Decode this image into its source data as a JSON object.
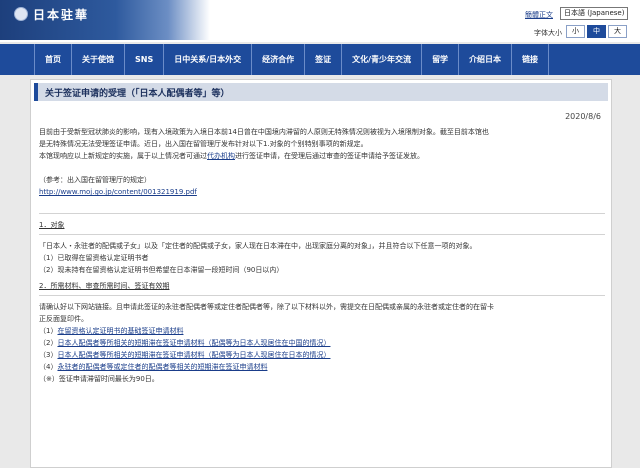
{
  "header": {
    "logo_text": "日本驻華",
    "lang_link": "簡體正文",
    "lang_select": "日本語 (Japanese)",
    "font_size_label": "字体大小",
    "font_sizes": [
      "小",
      "中",
      "大"
    ],
    "font_size_selected": "中"
  },
  "nav": {
    "items": [
      "首页",
      "关于使馆",
      "SNS",
      "日中关系/日本外交",
      "经济合作",
      "签证",
      "文化/青少年交流",
      "留学",
      "介绍日本",
      "链接"
    ]
  },
  "page": {
    "title": "关于签证申请的受理（「日本人配偶者等」等）",
    "date": "2020/8/6",
    "intro": [
      "目前由于受新型冠状肺炎的影响，现有入境政策为入境日本前14日曾在中国境内滞留的人原则无特殊情况则被视为入境限制对象。截至目前本馆也",
      "是无特殊情况无法受理签证申请。近日，出入国在留管理厅发布针对以下1.对象的个别特别事项的新规定。"
    ],
    "intro2_parts": [
      "本馆现响应以上新规定的实施，属于以上情况者可通过",
      "代办机构",
      "进行签证申请，在受理后通过审查的签证申请给予签证发放。"
    ],
    "reference_label": "（参考：出入国在留管理厅的规定）",
    "reference_url": "http://www.moj.go.jp/content/001321919.pdf",
    "section1": {
      "heading": "1．对象",
      "lines": [
        "「日本人・永驻者的配偶或子女」以及「定住者的配偶或子女，家人现在日本滞在中，出现家庭分离的对象」，并且符合以下任意一项的对象。",
        "（1）已取得在留资格认定证明书者",
        "（2）现未持有在留资格认定证明书但希望在日本滞留一段短时间（90日以内）"
      ]
    },
    "section2": {
      "heading": "2．所需材料、审查所需时间、签证有效期",
      "lines": [
        "请确认好以下网站链接。且申请此签证的永驻者配偶者等或定住者配偶者等，除了以下材料以外，需提交在日配偶或亲属的永驻者或定住者的在留卡",
        "正反面复印件。"
      ],
      "links": [
        {
          "num": "（1）",
          "text": "在留资格认定证明书的基础签证申请材料"
        },
        {
          "num": "（2）",
          "text": "日本人配偶者等所相关的短期滞在签证申请材料（配偶等为日本人现居住在中国的情况）"
        },
        {
          "num": "（3）",
          "text": "日本人配偶者等所相关的短期滞在签证申请材料（配偶等为日本人现居住在日本的情况）"
        },
        {
          "num": "（4）",
          "text": "永驻者的配偶者等或定住者的配偶者等相关的短期滞在签证申请材料"
        }
      ],
      "note": "（※）签证申请滞留时间最长为90日。"
    }
  },
  "colors": {
    "nav_bg": "#1e4b9b",
    "title_bar_bg": "#d4dbe7",
    "link": "#1a3d8a"
  }
}
